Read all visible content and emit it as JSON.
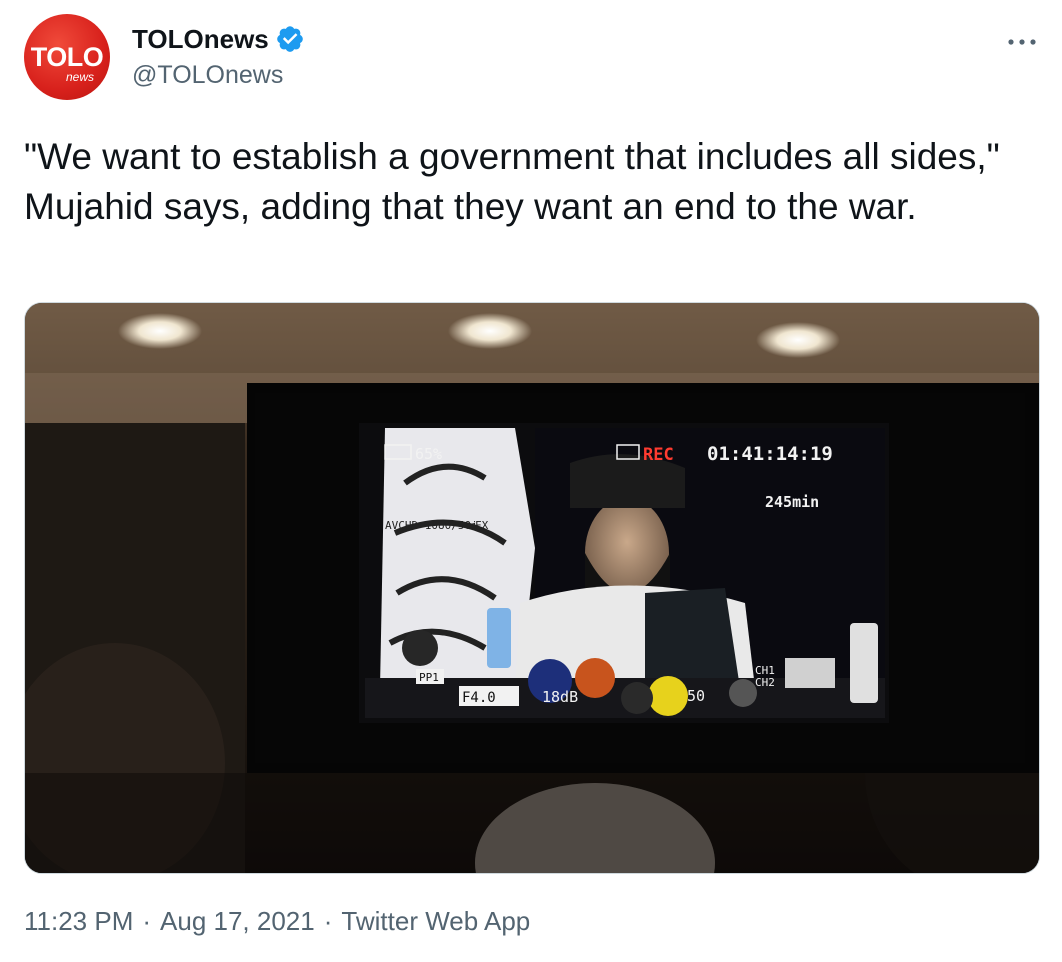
{
  "author": {
    "display_name": "TOLOnews",
    "handle": "@TOLOnews",
    "avatar_logo": "TOLO",
    "avatar_sublogo": "news",
    "avatar_color": "#d8211c",
    "verified": true,
    "verified_icon": "verified-badge-icon",
    "verified_color": "#1d9bf0"
  },
  "menu_icon": "more-icon",
  "tweet": {
    "text": "\"We want to establish a government that includes all sides,\" Mujahid says, adding that they want an end to the war."
  },
  "media": {
    "camera_overlay": {
      "battery": "65%",
      "rec_label": "REC",
      "timecode": "01:41:14:19",
      "remaining": "245min",
      "format": "AVCHD 1080/50i",
      "fx_label": "FX",
      "preset": "PP1",
      "aperture": "F4.0",
      "gain": "18dB",
      "shutter": "50",
      "ch1": "CH1",
      "ch2": "CH2"
    }
  },
  "footer": {
    "time": "11:23 PM",
    "separator": "·",
    "date": "Aug 17, 2021",
    "source": "Twitter Web App"
  }
}
